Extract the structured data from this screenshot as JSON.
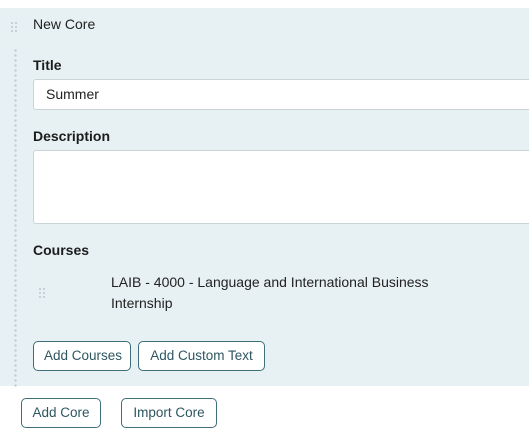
{
  "core": {
    "header_title": "New Core",
    "title_label": "Title",
    "title_value": "Summer",
    "description_label": "Description",
    "description_value": "",
    "courses_label": "Courses",
    "courses": [
      {
        "text": "LAIB - 4000 - Language and International Business Internship"
      }
    ],
    "add_courses_label": "Add Courses",
    "add_custom_text_label": "Add Custom Text"
  },
  "footer": {
    "add_core_label": "Add Core",
    "import_core_label": "Import Core"
  },
  "icons": {
    "header_handle": "drag-handle-icon",
    "course_handle": "drag-handle-icon"
  },
  "colors": {
    "panel_bg": "#e7f1f3",
    "button_border": "#3f6f7a",
    "button_text": "#2d5660"
  }
}
